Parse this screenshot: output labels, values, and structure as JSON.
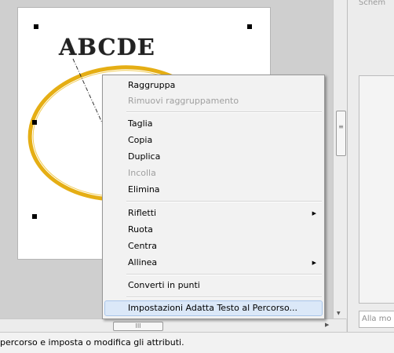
{
  "artboard": {
    "embroidery_text": "ABCDE",
    "path_color": "#e5ae14"
  },
  "context_menu": {
    "items": [
      {
        "label": "Raggruppa",
        "enabled": true
      },
      {
        "label": "Rimuovi raggruppamento",
        "enabled": false
      },
      {
        "label": "Taglia",
        "enabled": true
      },
      {
        "label": "Copia",
        "enabled": true
      },
      {
        "label": "Duplica",
        "enabled": true
      },
      {
        "label": "Incolla",
        "enabled": false
      },
      {
        "label": "Elimina",
        "enabled": true
      },
      {
        "label": "Rifletti",
        "enabled": true,
        "submenu": true
      },
      {
        "label": "Ruota",
        "enabled": true
      },
      {
        "label": "Centra",
        "enabled": true
      },
      {
        "label": "Allinea",
        "enabled": true,
        "submenu": true
      },
      {
        "label": "Converti in punti",
        "enabled": true
      },
      {
        "label": "Impostazioni Adatta Testo al Percorso...",
        "enabled": true,
        "highlighted": true
      }
    ]
  },
  "right_panel": {
    "header": "Schem",
    "footer_input_value": "Alla mo"
  },
  "scrollbars": {
    "vertical_grip": "≡",
    "horizontal_grip": "III"
  },
  "status_bar": {
    "text": "percorso e imposta o modifica gli attributi."
  },
  "colors": {
    "menu_highlight": "#dbe8f8",
    "menu_highlight_border": "#a9c6ea",
    "disabled_text": "#a0a0a0"
  }
}
